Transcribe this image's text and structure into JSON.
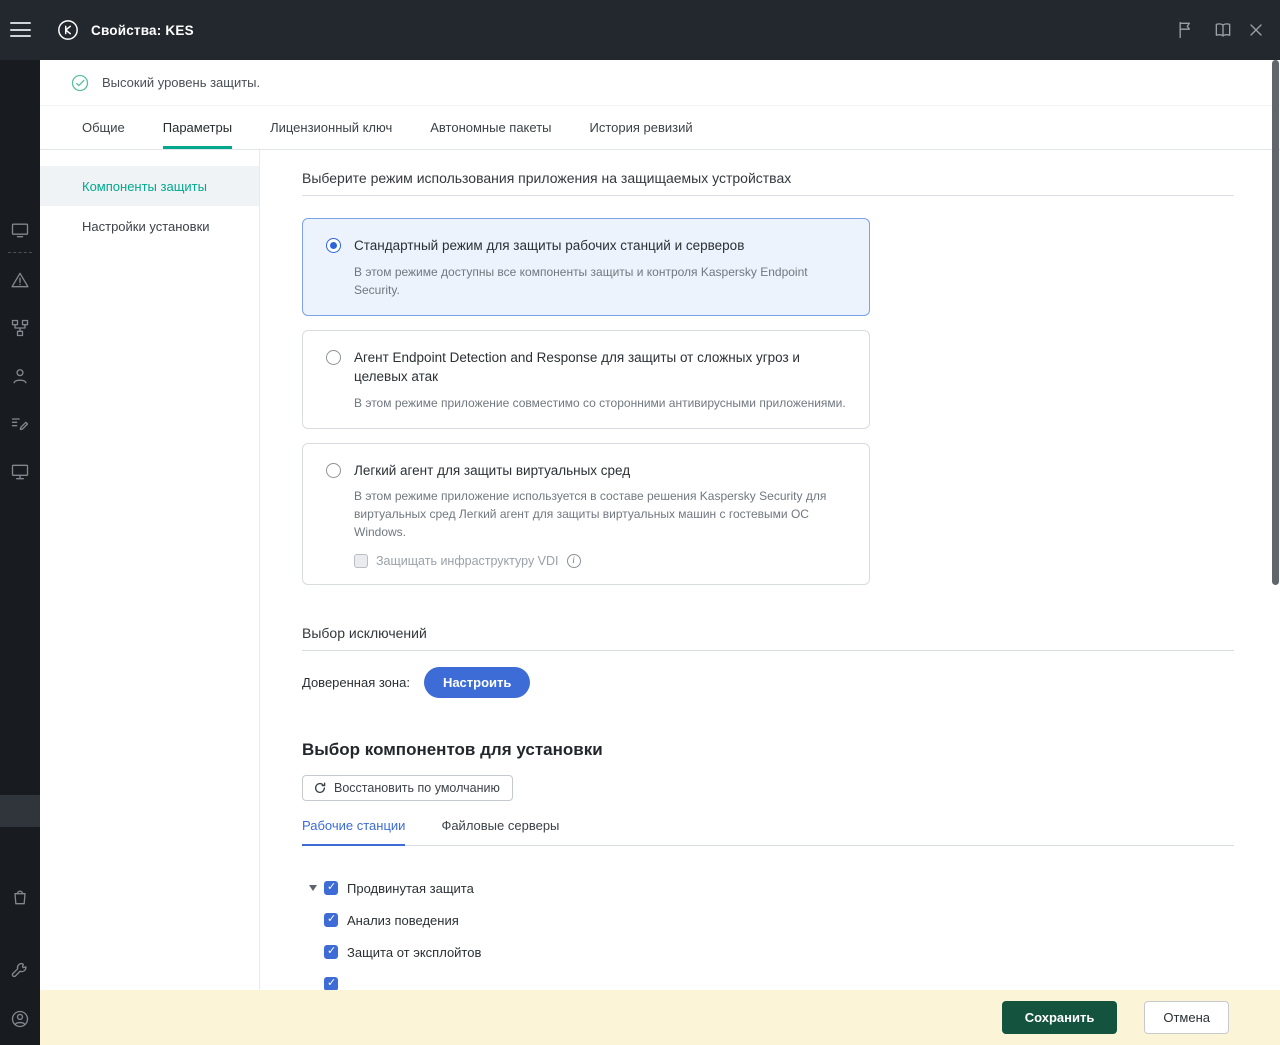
{
  "window": {
    "title": "Свойства: KES"
  },
  "banner": {
    "text": "Высокий уровень защиты."
  },
  "tabs": [
    {
      "label": "Общие",
      "active": false
    },
    {
      "label": "Параметры",
      "active": true
    },
    {
      "label": "Лицензионный ключ",
      "active": false
    },
    {
      "label": "Автономные пакеты",
      "active": false
    },
    {
      "label": "История ревизий",
      "active": false
    }
  ],
  "sidebar": {
    "items": [
      {
        "label": "Компоненты защиты",
        "active": true
      },
      {
        "label": "Настройки установки",
        "active": false
      }
    ]
  },
  "mode_section": {
    "title": "Выберите режим использования приложения на защищаемых устройствах",
    "options": [
      {
        "title": "Стандартный режим для защиты рабочих станций и серверов",
        "desc": "В этом режиме доступны все компоненты защиты и контроля Kaspersky Endpoint Security.",
        "selected": true
      },
      {
        "title": "Агент Endpoint Detection and Response для защиты от сложных угроз и целевых атак",
        "desc": "В этом режиме приложение совместимо со сторонними антивирусными приложениями.",
        "selected": false
      },
      {
        "title": "Легкий агент для защиты виртуальных сред",
        "desc": "В этом режиме приложение используется в составе решения Kaspersky Security для виртуальных сред Легкий агент для защиты виртуальных машин с гостевыми ОС Windows.",
        "selected": false,
        "checkbox_label": "Защищать инфраструктуру VDI",
        "checkbox_checked": false
      }
    ]
  },
  "exclusions": {
    "title": "Выбор исключений",
    "label": "Доверенная зона:",
    "button": "Настроить"
  },
  "components": {
    "title": "Выбор компонентов для установки",
    "reset_button": "Восстановить по умолчанию",
    "tabs": [
      {
        "label": "Рабочие станции",
        "active": true
      },
      {
        "label": "Файловые серверы",
        "active": false
      }
    ],
    "tree": {
      "group": "Продвинутая защита",
      "group_checked": true,
      "items": [
        {
          "label": "Анализ поведения",
          "checked": true
        },
        {
          "label": "Защита от эксплойтов",
          "checked": true
        }
      ]
    }
  },
  "footer": {
    "save": "Сохранить",
    "cancel": "Отмена"
  },
  "icons": {
    "rail": [
      "menu",
      "console",
      "alert-triangle",
      "hierarchy",
      "user",
      "tasks-edit",
      "devices",
      "marketplace-bag",
      "wrench",
      "account-circle"
    ],
    "titlebar": [
      "kaspersky-logo",
      "flag",
      "manual-book",
      "close"
    ],
    "banner": "check-circle",
    "reset": "refresh-arrow",
    "vdi": "info-circle"
  },
  "colors": {
    "accent_green": "#00a88e",
    "accent_blue": "#3d6cd6",
    "selected_card_bg": "#edf3fc",
    "footer_bg": "#fcf4d6",
    "save_button": "#14543e",
    "rail_bg": "#181b20",
    "titlebar_bg": "#23282e"
  }
}
